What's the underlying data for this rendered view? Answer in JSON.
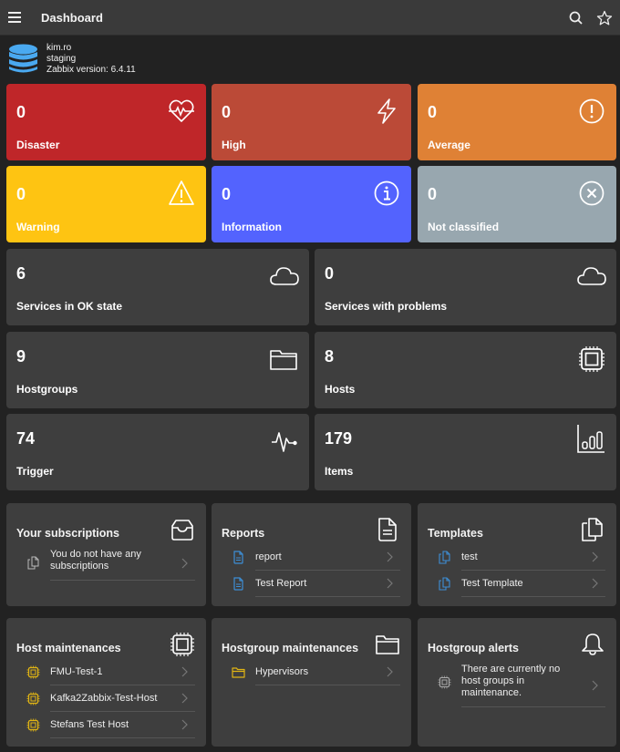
{
  "header": {
    "title": "Dashboard",
    "menu_icon": "hamburger-icon",
    "search_icon": "search-icon",
    "favorite_icon": "star-icon"
  },
  "server": {
    "icon": "database-icon",
    "name": "kim.ro",
    "environment": "staging",
    "version": "Zabbix version: 6.4.11"
  },
  "severities": [
    {
      "value": "0",
      "label": "Disaster",
      "icon": "heartbeat-icon",
      "color": "#bf2629"
    },
    {
      "value": "0",
      "label": "High",
      "icon": "lightning-icon",
      "color": "#bb4a37"
    },
    {
      "value": "0",
      "label": "Average",
      "icon": "exclamation-circle-icon",
      "color": "#df8135"
    },
    {
      "value": "0",
      "label": "Warning",
      "icon": "warning-triangle-icon",
      "color": "#fec412"
    },
    {
      "value": "0",
      "label": "Information",
      "icon": "info-circle-icon",
      "color": "#5363fe"
    },
    {
      "value": "0",
      "label": "Not classified",
      "icon": "x-circle-icon",
      "color": "#98a7af"
    }
  ],
  "stats": [
    {
      "value": "6",
      "label": "Services in OK state",
      "icon": "cloud-icon"
    },
    {
      "value": "0",
      "label": "Services with problems",
      "icon": "cloud-icon"
    },
    {
      "value": "9",
      "label": "Hostgroups",
      "icon": "folder-icon"
    },
    {
      "value": "8",
      "label": "Hosts",
      "icon": "chip-icon"
    },
    {
      "value": "74",
      "label": "Trigger",
      "icon": "pulse-icon"
    },
    {
      "value": "179",
      "label": "Items",
      "icon": "bar-chart-icon"
    }
  ],
  "cards": {
    "subscriptions": {
      "title": "Your subscriptions",
      "icon": "inbox-icon",
      "items": [
        {
          "text": "You do not have any subscriptions",
          "icon": "copy-icon"
        }
      ]
    },
    "reports": {
      "title": "Reports",
      "icon": "document-icon",
      "items": [
        {
          "text": "report",
          "icon": "document-icon"
        },
        {
          "text": "Test Report",
          "icon": "document-icon"
        }
      ]
    },
    "templates": {
      "title": "Templates",
      "icon": "copy-icon",
      "items": [
        {
          "text": "test",
          "icon": "copy-icon"
        },
        {
          "text": "Test Template",
          "icon": "copy-icon"
        }
      ]
    },
    "host_maintenances": {
      "title": "Host maintenances",
      "icon": "chip-icon",
      "items": [
        {
          "text": "FMU-Test-1",
          "icon": "chip-icon"
        },
        {
          "text": "Kafka2Zabbix-Test-Host",
          "icon": "chip-icon"
        },
        {
          "text": "Stefans Test Host",
          "icon": "chip-icon"
        }
      ]
    },
    "hostgroup_maintenances": {
      "title": "Hostgroup maintenances",
      "icon": "folder-icon",
      "items": [
        {
          "text": "Hypervisors",
          "icon": "folder-icon"
        }
      ]
    },
    "hostgroup_alerts": {
      "title": "Hostgroup alerts",
      "icon": "bell-icon",
      "items": [
        {
          "text": "There are currently no host groups in maintenance.",
          "icon": "chip-icon"
        }
      ]
    }
  },
  "colors": {
    "background": "#222222",
    "header": "#3a3a3a",
    "card": "#3e3e3e",
    "accent_blue": "#4aa9f0",
    "report_icon": "#3d8fd6",
    "maintenance_icon": "#e0b414"
  }
}
